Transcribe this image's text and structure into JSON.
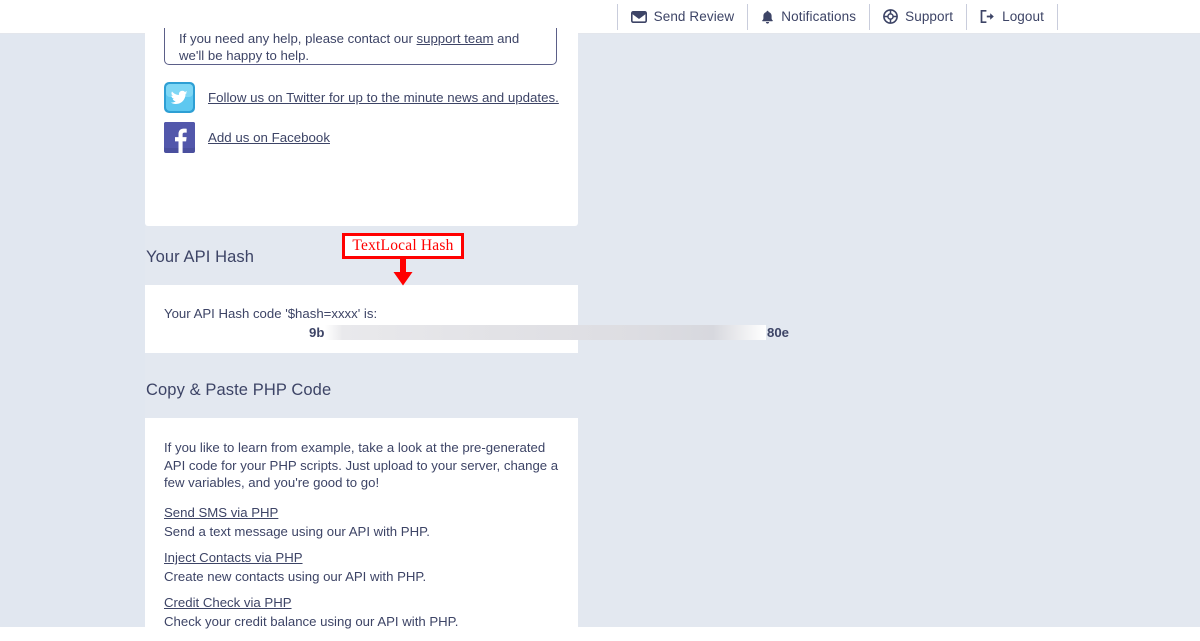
{
  "topnav": {
    "items": [
      {
        "label": "Send Review",
        "icon": "envelope-icon"
      },
      {
        "label": "Notifications",
        "icon": "bell-icon"
      },
      {
        "label": "Support",
        "icon": "lifebuoy-icon"
      },
      {
        "label": "Logout",
        "icon": "logout-icon"
      }
    ]
  },
  "help": {
    "text_before": "If you need any help, please contact our ",
    "link": "support team",
    "text_after": " and we'll be happy to help."
  },
  "social": [
    {
      "icon": "twitter-icon",
      "label": "Follow us on Twitter for up to the minute news and updates."
    },
    {
      "icon": "facebook-icon",
      "label": "Add us on Facebook"
    }
  ],
  "api_hash": {
    "heading": "Your API Hash",
    "label": "Your API Hash code '$hash=xxxx' is:",
    "hash_prefix": "9b",
    "hash_suffix": "80e"
  },
  "php": {
    "heading": "Copy & Paste PHP Code",
    "intro": "If you like to learn from example, take a look at the pre-generated API code for your PHP scripts. Just upload to your server, change a few variables, and you're good to go!",
    "links": [
      {
        "title": "Send SMS via PHP ",
        "desc": "Send a text message using our API with PHP."
      },
      {
        "title": "Inject Contacts via PHP ",
        "desc": "Create new contacts using our API with PHP."
      },
      {
        "title": "Credit Check via PHP ",
        "desc": "Check your credit balance using our API with PHP."
      }
    ]
  },
  "annotation": {
    "label": "TextLocal Hash",
    "color": "#ff0000"
  },
  "colors": {
    "page_background": "#e3e8f0",
    "panel_background": "#ffffff",
    "text": "#3d4466",
    "divider": "#c3cddd",
    "annotation_red": "#ff0000",
    "twitter_blue": "#55c8ee",
    "facebook_blue": "#4a4f9e"
  }
}
